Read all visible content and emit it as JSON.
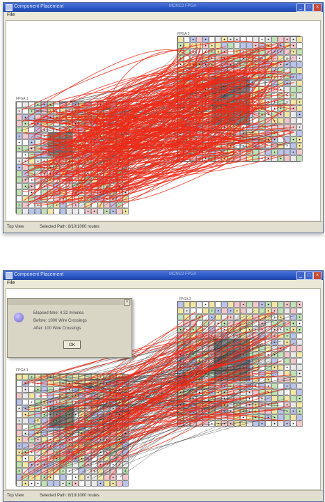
{
  "colors": {
    "title_bar": "#2a56c4",
    "route_red": "#ee2a18",
    "grid_line": "#444444",
    "block_pink": "#f3c7cc",
    "block_green": "#bfe3b4",
    "block_blue": "#b9c3ec",
    "block_yellow": "#f2e6a3"
  },
  "window1": {
    "title": "Component Placement",
    "title_right": "MCNC2 FPGA",
    "menu_file": "File",
    "chip_left_label": "FPGA 1",
    "chip_right_label": "FPGA 2",
    "status_left": "Top View",
    "status_right": "Selected Path: 8/10/1000 routes"
  },
  "window2": {
    "title": "Component Placement",
    "title_right": "MCNC2 FPGA",
    "menu_file": "File",
    "chip_left_label": "FPGA 1",
    "chip_right_label": "FPGA 2",
    "status_left": "Top View",
    "status_right": "Selected Path: 8/10/1000 routes"
  },
  "dialog": {
    "line1": "Elapsed time: 4.32 minutes",
    "line2": "Before: 1000 Wire Crossings",
    "line3": "After: 100 Wire Crossings",
    "ok_label": "OK"
  }
}
